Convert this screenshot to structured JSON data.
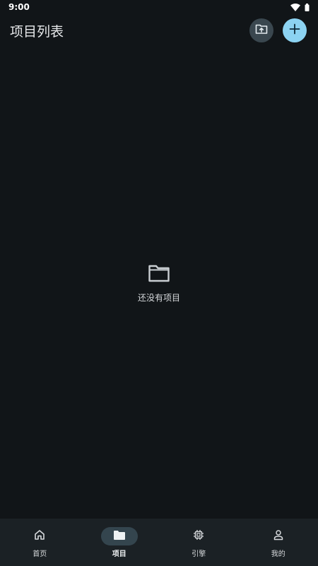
{
  "status_bar": {
    "time": "9:00",
    "icons": [
      "wifi-icon",
      "battery-icon"
    ]
  },
  "header": {
    "title": "项目列表",
    "actions": [
      {
        "icon": "folder-upload-icon",
        "color": "#3a474f"
      },
      {
        "icon": "plus-icon",
        "color": "#8cd3f2"
      }
    ]
  },
  "empty_state": {
    "icon": "folder-outline-icon",
    "message": "还没有项目"
  },
  "bottom_nav": {
    "items": [
      {
        "label": "首页",
        "icon": "home-icon",
        "active": false
      },
      {
        "label": "项目",
        "icon": "folder-icon",
        "active": true
      },
      {
        "label": "引擎",
        "icon": "chip-icon",
        "active": false
      },
      {
        "label": "我的",
        "icon": "person-icon",
        "active": false
      }
    ]
  },
  "colors": {
    "background": "#111518",
    "accent": "#8cd3f2",
    "nav_background": "#1b2125"
  }
}
